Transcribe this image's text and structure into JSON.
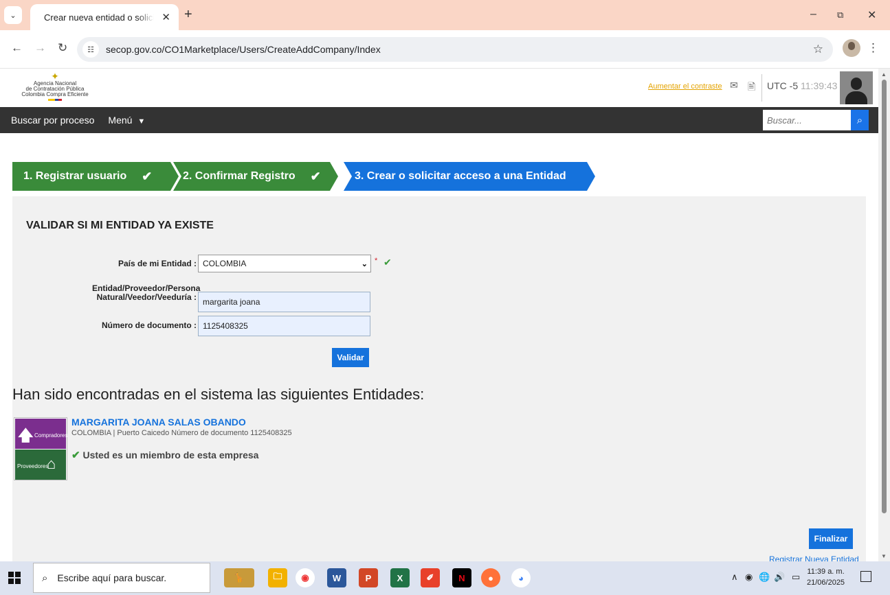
{
  "browser": {
    "tab_title": "Crear nueva entidad o solicitar acceso",
    "url": "secop.gov.co/CO1Marketplace/Users/CreateAddCompany/Index"
  },
  "header": {
    "logo_lines": [
      "Agencia Nacional",
      "de Contratación Pública",
      "Colombia Compra Eficiente"
    ],
    "contrast_link": "Aumentar el contraste",
    "timezone": "UTC -5",
    "time": "11:39:43"
  },
  "navbar": {
    "search_by_process": "Buscar por proceso",
    "menu": "Menú",
    "search_placeholder": "Buscar..."
  },
  "steps": [
    {
      "label": "1. Registrar usuario",
      "done": true
    },
    {
      "label": "2. Confirmar Registro",
      "done": true
    },
    {
      "label": "3. Crear o solicitar acceso a una Entidad",
      "done": false
    }
  ],
  "form": {
    "title": "VALIDAR SI MI ENTIDAD YA EXISTE",
    "country_label": "País de mi Entidad :",
    "country_value": "COLOMBIA",
    "required_mark": "*",
    "entity_label_line1": "Entidad/Proveedor/Persona",
    "entity_label_line2": "Natural/Veedor/Veeduría :",
    "entity_value": "margarita joana",
    "doc_label": "Número de documento :",
    "doc_value": "1125408325",
    "validate_button": "Validar"
  },
  "results": {
    "title": "Han sido encontradas en el sistema las siguientes Entidades:",
    "entity_name": "MARGARITA JOANA SALAS OBANDO",
    "entity_meta": "COLOMBIA | Puerto Caicedo  Número de documento 1125408325",
    "member_text": "Usted es un miembro de esta empresa",
    "logo_top_label": "Compradores",
    "logo_bottom_label": "Proveedores"
  },
  "footer": {
    "finish_button": "Finalizar",
    "register_link": "Registrar Nueva Entidad"
  },
  "taskbar": {
    "search_placeholder": "Escribe aquí para buscar.",
    "time": "11:39 a. m.",
    "date": "21/06/2025"
  },
  "colors": {
    "step_done": "#3a8b3a",
    "step_active": "#1572dc",
    "navbar": "#333333",
    "link_blue": "#1572dc",
    "contrast_link": "#e4a300"
  }
}
